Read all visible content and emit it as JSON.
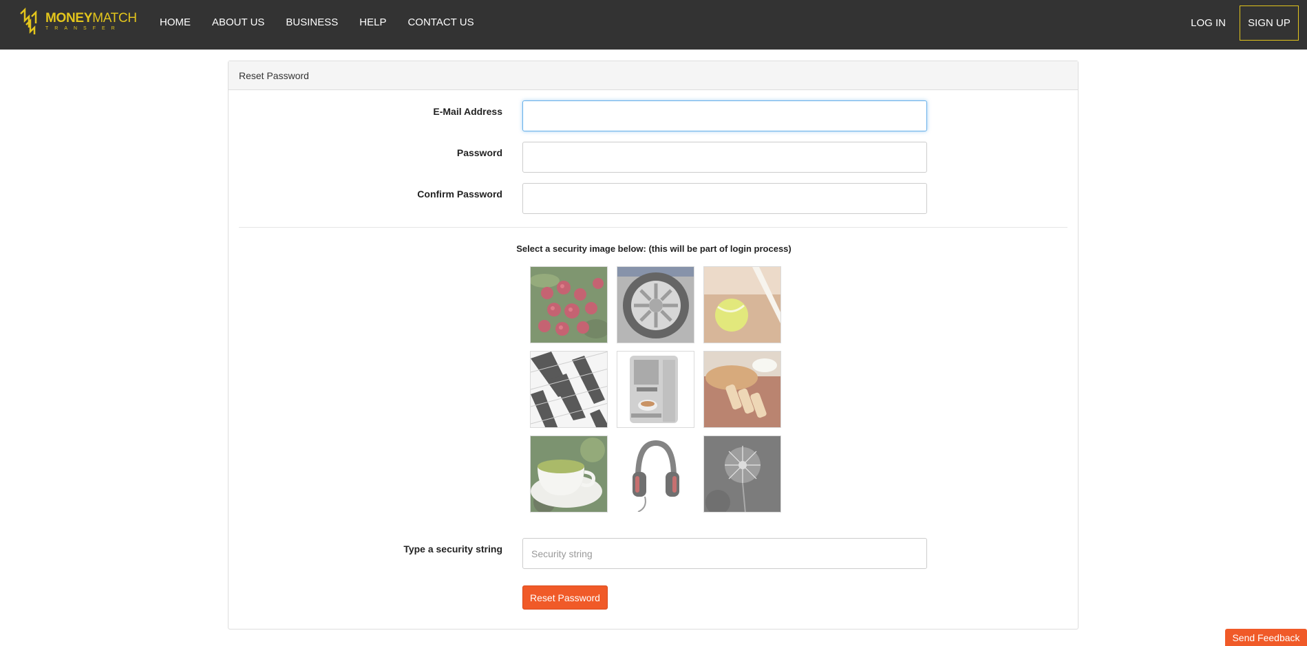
{
  "brand": {
    "name_bold": "MONEY",
    "name_thin": "MATCH",
    "tagline": "TRANSFER"
  },
  "nav": {
    "items": [
      {
        "label": "HOME"
      },
      {
        "label": "ABOUT US"
      },
      {
        "label": "BUSINESS"
      },
      {
        "label": "HELP"
      },
      {
        "label": "CONTACT US"
      }
    ]
  },
  "auth": {
    "login": "LOG IN",
    "signup": "SIGN UP"
  },
  "panel": {
    "title": "Reset Password"
  },
  "form": {
    "email_label": "E-Mail Address",
    "email_value": "",
    "password_label": "Password",
    "password_value": "",
    "confirm_label": "Confirm Password",
    "confirm_value": "",
    "security_title": "Select a security image below: (this will be part of login process)",
    "security_images": [
      {
        "name": "raspberries"
      },
      {
        "name": "car-wheel"
      },
      {
        "name": "tennis-ball"
      },
      {
        "name": "piano-keys"
      },
      {
        "name": "coffee-machine"
      },
      {
        "name": "bread"
      },
      {
        "name": "green-tea-cup"
      },
      {
        "name": "headphones"
      },
      {
        "name": "dandelion"
      }
    ],
    "security_string_label": "Type a security string",
    "security_string_placeholder": "Security string",
    "submit_label": "Reset Password"
  },
  "feedback": {
    "label": "Send Feedback"
  },
  "colors": {
    "topbar": "#333333",
    "brand": "#e3c51c",
    "accent": "#f05a28",
    "focus": "#66afe9"
  }
}
